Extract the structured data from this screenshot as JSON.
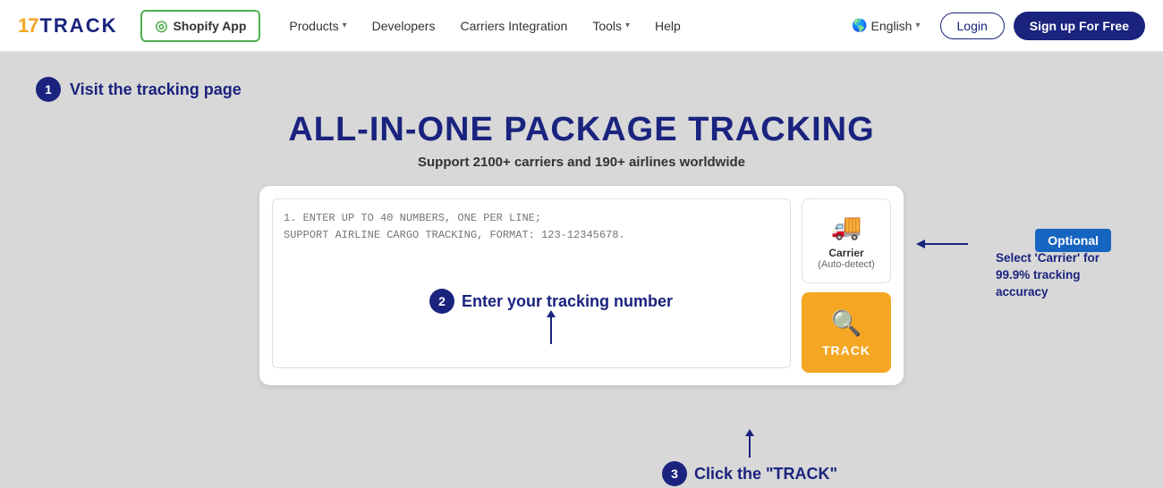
{
  "logo": {
    "num": "17",
    "word": "TRACK"
  },
  "nav": {
    "shopify_btn": "Shopify App",
    "products": "Products",
    "developers": "Developers",
    "carriers_integration": "Carriers Integration",
    "tools": "Tools",
    "help": "Help",
    "english": "English",
    "login": "Login",
    "signup": "Sign up For Free"
  },
  "hero": {
    "step1_label": "Visit the tracking page",
    "heading": "ALL-IN-ONE PACKAGE TRACKING",
    "subheading": "Support 2100+ carriers and 190+ airlines worldwide"
  },
  "textarea": {
    "placeholder_line1": "1. ENTER UP TO 40 NUMBERS, ONE PER LINE;",
    "placeholder_line2": "SUPPORT AIRLINE CARGO TRACKING, FORMAT: 123-12345678."
  },
  "carrier": {
    "label": "Carrier",
    "sublabel": "(Auto-detect)"
  },
  "track_btn": {
    "label": "TRACK"
  },
  "annotation": {
    "step2_label": "Enter your tracking number",
    "optional_label": "Optional",
    "optional_desc": "Select 'Carrier' for 99.9% tracking accuracy",
    "step3_label": "Click the \"TRACK\""
  }
}
